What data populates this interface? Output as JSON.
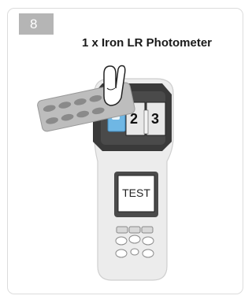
{
  "step": {
    "number": "8",
    "title": "1 x Iron LR Photometer"
  },
  "device": {
    "screen_text": "TEST",
    "chamber_labels": [
      "2",
      "3"
    ]
  },
  "colors": {
    "badge": "#b5b5b5",
    "device_body": "#ececec",
    "chamber_panel": "#3a3a3a",
    "cuvette": "#6fb7e4",
    "tablet_strip": "#bdbdbd"
  }
}
